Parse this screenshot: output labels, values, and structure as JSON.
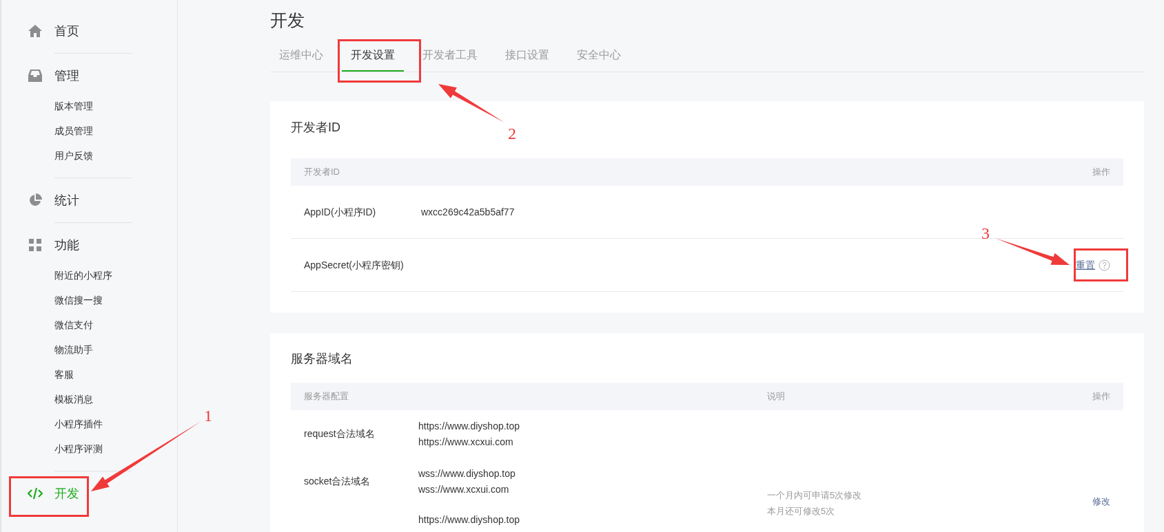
{
  "sidebar": {
    "items": [
      {
        "kind": "home",
        "label": "首页",
        "selected": false
      },
      {
        "kind": "inbox",
        "label": "管理",
        "selected": false,
        "children": [
          {
            "label": "版本管理",
            "selected": false
          },
          {
            "label": "成员管理",
            "selected": false
          },
          {
            "label": "用户反馈",
            "selected": false
          }
        ]
      },
      {
        "kind": "pie",
        "label": "统计",
        "selected": false
      },
      {
        "kind": "grid",
        "label": "功能",
        "selected": false,
        "children": [
          {
            "label": "附近的小程序",
            "selected": false
          },
          {
            "label": "微信搜一搜",
            "selected": false
          },
          {
            "label": "微信支付",
            "selected": false
          },
          {
            "label": "物流助手",
            "selected": false
          },
          {
            "label": "客服",
            "selected": false
          },
          {
            "label": "模板消息",
            "selected": false
          },
          {
            "label": "小程序插件",
            "selected": false
          },
          {
            "label": "小程序评测",
            "selected": false
          }
        ]
      },
      {
        "kind": "code",
        "label": "开发",
        "selected": true
      }
    ]
  },
  "page": {
    "title": "开发",
    "tabs": [
      {
        "label": "运维中心",
        "selected": false
      },
      {
        "label": "开发设置",
        "selected": true
      },
      {
        "label": "开发者工具",
        "selected": false
      },
      {
        "label": "接口设置",
        "selected": false
      },
      {
        "label": "安全中心",
        "selected": false
      }
    ]
  },
  "developer_id": {
    "title": "开发者ID",
    "columns": [
      "开发者ID",
      "操作"
    ],
    "rows": [
      {
        "name": "AppID(小程序ID)",
        "value": "wxcc269c42a5b5af77"
      },
      {
        "name": "AppSecret(小程序密钥)",
        "action": "重置"
      }
    ]
  },
  "server_domain": {
    "title": "服务器域名",
    "columns": [
      "服务器配置",
      "说明",
      "操作"
    ],
    "rows": [
      {
        "name": "request合法域名",
        "values": [
          "https://www.diyshop.top",
          "https://www.xcxui.com"
        ]
      },
      {
        "name": "socket合法域名",
        "values": [
          "wss://www.diyshop.top",
          "wss://www.xcxui.com"
        ]
      },
      {
        "values": [
          "https://www.diyshop.top"
        ]
      }
    ],
    "notes": [
      "一个月内可申请5次修改",
      "本月还可修改5次"
    ],
    "action": "修改"
  },
  "annotations": [
    {
      "label": "1"
    },
    {
      "label": "2"
    },
    {
      "label": "3"
    }
  ]
}
